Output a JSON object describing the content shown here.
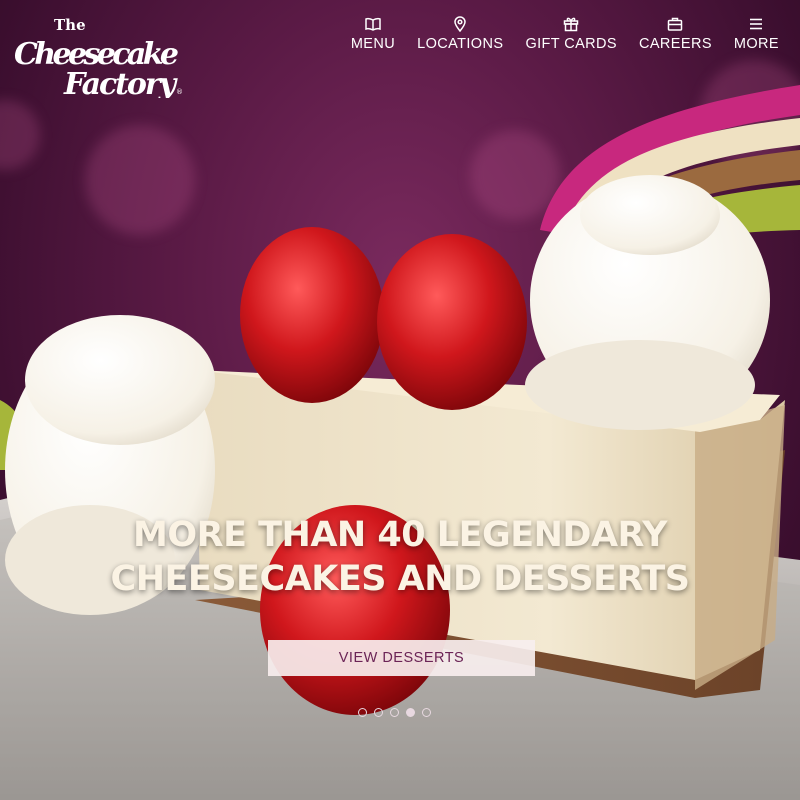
{
  "brand": {
    "logo_line1": "The",
    "logo_line2": "Cheesecake",
    "logo_line3": "Factory",
    "logo_mark": "®"
  },
  "nav": {
    "items": [
      {
        "label": "MENU",
        "icon": "book-icon"
      },
      {
        "label": "LOCATIONS",
        "icon": "map-pin-icon"
      },
      {
        "label": "GIFT CARDS",
        "icon": "gift-icon"
      },
      {
        "label": "CAREERS",
        "icon": "briefcase-icon"
      },
      {
        "label": "MORE",
        "icon": "hamburger-icon"
      }
    ]
  },
  "hero": {
    "headline_line1": "MORE THAN 40 LEGENDARY",
    "headline_line2": "CHEESECAKES AND DESSERTS",
    "cta_label": "VIEW DESSERTS",
    "slides_count": 5,
    "active_slide": 4
  },
  "colors": {
    "background": "#5a1a45",
    "headline": "#fbf3e4",
    "cta_text": "#6b2456",
    "cta_bg": "#f7eeee"
  }
}
